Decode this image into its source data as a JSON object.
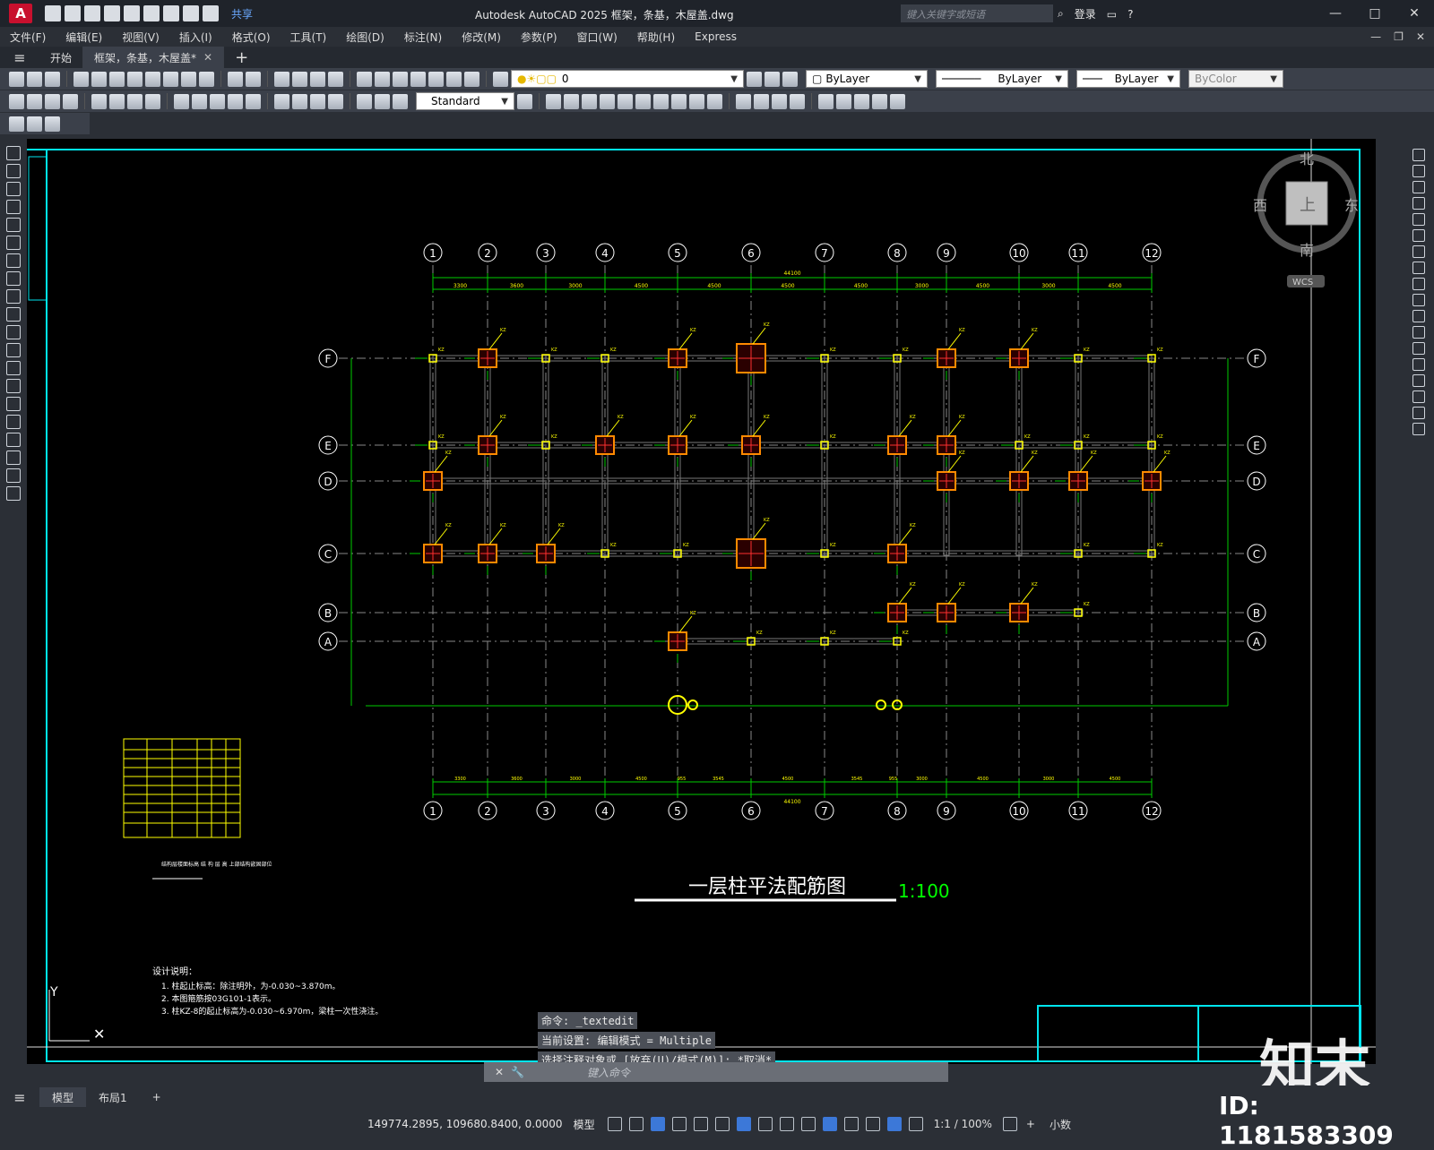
{
  "app": {
    "logo": "A",
    "title": "Autodesk AutoCAD 2025    框架，条基，木屋盖.dwg",
    "share": "共享",
    "search_placeholder": "键入关键字或短语",
    "login": "登录",
    "window_controls": [
      "—",
      "□",
      "✕"
    ]
  },
  "menu": [
    "文件(F)",
    "编辑(E)",
    "视图(V)",
    "插入(I)",
    "格式(O)",
    "工具(T)",
    "绘图(D)",
    "标注(N)",
    "修改(M)",
    "参数(P)",
    "窗口(W)",
    "帮助(H)",
    "Express"
  ],
  "tabs": [
    {
      "label": "开始"
    },
    {
      "label": "框架，条基，木屋盖*"
    }
  ],
  "toolbar": {
    "layer": "0",
    "text_style": "Standard",
    "color": "ByLayer",
    "linetype": "ByLayer",
    "lineweight": "ByLayer",
    "plotstyle": "ByColor"
  },
  "viewcube": {
    "north": "北",
    "south": "南",
    "east": "东",
    "west": "西",
    "top": "上",
    "wcs": "WCS"
  },
  "drawing": {
    "title": "一层柱平法配筋图",
    "scale": "1:100",
    "axes_numbers": [
      "1",
      "2",
      "3",
      "4",
      "5",
      "6",
      "7",
      "8",
      "9",
      "10",
      "11",
      "12"
    ],
    "axes_letters": [
      "F",
      "E",
      "D",
      "C",
      "B",
      "A"
    ],
    "top_dims": [
      "3300",
      "3600",
      "3000",
      "4500",
      "4500",
      "4500",
      "4500",
      "3000",
      "4500",
      "3000",
      "4500"
    ],
    "bottom_dims": [
      "3300",
      "3600",
      "3000",
      "4500",
      "955",
      "3545",
      "4500",
      "3545",
      "955",
      "3000",
      "4500",
      "3000",
      "4500"
    ],
    "total_dim": "44100",
    "notes_title": "设计说明：",
    "notes": [
      "1. 柱起止标高：除注明外，为-0.030~3.870m。",
      "2. 本图箍筋按03G101-1表示。",
      "3. 柱KZ-8的起止标高为-0.030~6.970m，梁柱一次性浇注。"
    ],
    "ucs_y": "Y",
    "ucs_x": "✕",
    "small_label": "结构层楼面标高 结 构 层 高 上部结构嵌固部位"
  },
  "command": {
    "history": [
      "命令: _textedit",
      "当前设置: 编辑模式 = Multiple",
      "选择注释对象或 [放弃(U)/模式(M)]: *取消*"
    ],
    "placeholder": "键入命令"
  },
  "layout_tabs": [
    "模型",
    "布局1"
  ],
  "status": {
    "coords": "149774.2895, 109680.8400, 0.0000",
    "mode": "模型",
    "scale": "1:1 / 100%",
    "units": "小数"
  },
  "watermark": {
    "logo": "知末",
    "id": "ID: 1181583309"
  },
  "colors": {
    "canvas_bg": "#000000",
    "grid_green": "#00cc00",
    "column_orange": "#ff8a00",
    "text_yellow": "#ffff00",
    "border_cyan": "#00e5ee",
    "axis_white": "#ffffff"
  }
}
